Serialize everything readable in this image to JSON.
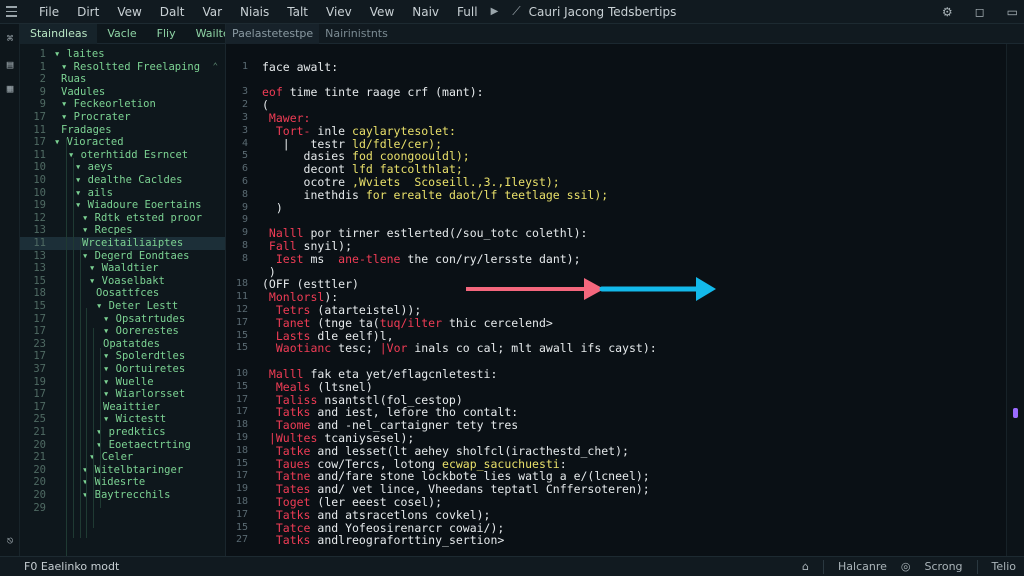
{
  "menubar": {
    "items": [
      "File",
      "Dirt",
      "Vew",
      "Dalt",
      "Var",
      "Niais",
      "Talt",
      "Viev",
      "Vew",
      "Naiv",
      "Full"
    ],
    "title": "Cauri Jacong Tedsbertips",
    "icons": [
      "hamburger-icon",
      "play-icon",
      "logo-icon",
      "settings-icon",
      "minimize-icon",
      "close-icon"
    ]
  },
  "explorer": {
    "tabs": [
      "Staindleas",
      "Vacle",
      "Fliy",
      "Wailtes"
    ],
    "tree": [
      {
        "ln": "1",
        "label": "▾ laites",
        "indent": 0
      },
      {
        "ln": "1",
        "label": "▾ Resoltted Freelaping",
        "indent": 1,
        "chev": "⌃"
      },
      {
        "ln": "2",
        "label": "Ruas",
        "indent": 1
      },
      {
        "ln": "9",
        "label": "Vadules",
        "indent": 1
      },
      {
        "ln": "9",
        "label": "▾ Feckeorletion",
        "indent": 1
      },
      {
        "ln": "17",
        "label": "▾ Procrater",
        "indent": 1
      },
      {
        "ln": "11",
        "label": "Fradages",
        "indent": 1
      },
      {
        "ln": "17",
        "label": "▾ Vioracted",
        "indent": 0
      },
      {
        "ln": "11",
        "label": "▾ oterhtidd Esrncet",
        "indent": 2
      },
      {
        "ln": "10",
        "label": "▾ aeys",
        "indent": 3
      },
      {
        "ln": "10",
        "label": "▾ dealthe Cacldes",
        "indent": 3
      },
      {
        "ln": "10",
        "label": "▾ ails",
        "indent": 3
      },
      {
        "ln": "19",
        "label": "▾ Wiadoure Eoertains",
        "indent": 3
      },
      {
        "ln": "12",
        "label": "▾ Rdtk etsted proor",
        "indent": 4
      },
      {
        "ln": "13",
        "label": "▾ Recpes",
        "indent": 4
      },
      {
        "ln": "11",
        "label": "Wrceitailiaiptes",
        "indent": 4,
        "selected": true
      },
      {
        "ln": "13",
        "label": "▾ Degerd Eondtaes",
        "indent": 4
      },
      {
        "ln": "13",
        "label": "▾ Waaldtier",
        "indent": 5
      },
      {
        "ln": "15",
        "label": "▾ Voaselbakt",
        "indent": 5
      },
      {
        "ln": "18",
        "label": "Oosattfces",
        "indent": 6
      },
      {
        "ln": "15",
        "label": "▾ Deter Lestt",
        "indent": 6
      },
      {
        "ln": "17",
        "label": "▾ Opsatrtudes",
        "indent": 7
      },
      {
        "ln": "17",
        "label": "▾ Oorerestes",
        "indent": 7
      },
      {
        "ln": "23",
        "label": "Opatatdes",
        "indent": 7
      },
      {
        "ln": "17",
        "label": "▾ Spolerdtles",
        "indent": 7
      },
      {
        "ln": "37",
        "label": "▾ Oortuiretes",
        "indent": 7
      },
      {
        "ln": "19",
        "label": "▾ Wuelle",
        "indent": 7
      },
      {
        "ln": "17",
        "label": "▾ Wiarlorsset",
        "indent": 7
      },
      {
        "ln": "17",
        "label": "Weaittier",
        "indent": 7
      },
      {
        "ln": "25",
        "label": "▾ Wictestt",
        "indent": 7
      },
      {
        "ln": "21",
        "label": "▾ predktics",
        "indent": 6
      },
      {
        "ln": "20",
        "label": "▾ Eoetaectrting",
        "indent": 6
      },
      {
        "ln": "21",
        "label": "▾ Celer",
        "indent": 5
      },
      {
        "ln": "20",
        "label": "▾ Witelbtaringer",
        "indent": 4
      },
      {
        "ln": "20",
        "label": "▾ Widesrte",
        "indent": 4
      },
      {
        "ln": "20",
        "label": "▾ Baytrecchils",
        "indent": 4
      },
      {
        "ln": "29",
        "label": "",
        "indent": 0
      }
    ]
  },
  "editor": {
    "tabs": [
      "Paelastetestpe",
      "Nairinistnts"
    ],
    "lines": [
      {
        "ln": "",
        "segments": [
          {
            "c": "white",
            "t": ""
          }
        ]
      },
      {
        "ln": "1",
        "segments": [
          {
            "c": "white",
            "t": "face awalt:"
          }
        ]
      },
      {
        "ln": "",
        "segments": [
          {
            "c": "white",
            "t": ""
          }
        ]
      },
      {
        "ln": "3",
        "segments": [
          {
            "c": "red",
            "t": "eof "
          },
          {
            "c": "white",
            "t": "time tinte raage crf (mant):"
          }
        ]
      },
      {
        "ln": "2",
        "segments": [
          {
            "c": "white",
            "t": "("
          }
        ]
      },
      {
        "ln": "3",
        "segments": [
          {
            "c": "red",
            "t": " Mawer:"
          }
        ]
      },
      {
        "ln": "3",
        "segments": [
          {
            "c": "red",
            "t": "  Tort- "
          },
          {
            "c": "white",
            "t": "inle "
          },
          {
            "c": "yellow",
            "t": "caylarytesolet:"
          }
        ]
      },
      {
        "ln": "4",
        "segments": [
          {
            "c": "white",
            "t": "   |   testr "
          },
          {
            "c": "yellow",
            "t": "ld/fdle/cer);"
          }
        ]
      },
      {
        "ln": "5",
        "segments": [
          {
            "c": "white",
            "t": "      dasies "
          },
          {
            "c": "yellow",
            "t": "fod coongoouldl);"
          }
        ]
      },
      {
        "ln": "6",
        "segments": [
          {
            "c": "white",
            "t": "      decont "
          },
          {
            "c": "yellow",
            "t": "lfd fatcolthlat;"
          }
        ]
      },
      {
        "ln": "6",
        "segments": [
          {
            "c": "white",
            "t": "      ocotre "
          },
          {
            "c": "yellow",
            "t": ",Wviets  Scoseill.,3.,Ileyst);"
          }
        ]
      },
      {
        "ln": "8",
        "segments": [
          {
            "c": "white",
            "t": "      inethdis "
          },
          {
            "c": "yellow",
            "t": "for erealte daot/lf teetlage ssil);"
          }
        ]
      },
      {
        "ln": "9",
        "segments": [
          {
            "c": "white",
            "t": "  )"
          }
        ]
      },
      {
        "ln": "9",
        "segments": [
          {
            "c": "white",
            "t": ""
          }
        ]
      },
      {
        "ln": "9",
        "segments": [
          {
            "c": "red",
            "t": " Nalll "
          },
          {
            "c": "white",
            "t": "por tirner estlerted(/sou_totc colethl):"
          }
        ]
      },
      {
        "ln": "8",
        "segments": [
          {
            "c": "red",
            "t": " Fall "
          },
          {
            "c": "white",
            "t": "snyil);"
          }
        ]
      },
      {
        "ln": "8",
        "segments": [
          {
            "c": "red",
            "t": "  Iest "
          },
          {
            "c": "white",
            "t": "ms  "
          },
          {
            "c": "red",
            "t": "ane-tlene "
          },
          {
            "c": "white",
            "t": "the con/ry/lersste dant);"
          }
        ]
      },
      {
        "ln": "",
        "segments": [
          {
            "c": "white",
            "t": " )"
          }
        ]
      },
      {
        "ln": "18",
        "segments": [
          {
            "c": "white",
            "t": "(OFF (esttler)"
          }
        ]
      },
      {
        "ln": "11",
        "segments": [
          {
            "c": "red",
            "t": " Monlorsl"
          },
          {
            "c": "white",
            "t": "):"
          }
        ]
      },
      {
        "ln": "12",
        "segments": [
          {
            "c": "red",
            "t": "  Tetrs "
          },
          {
            "c": "white",
            "t": "(atarteistel));"
          }
        ]
      },
      {
        "ln": "17",
        "segments": [
          {
            "c": "red",
            "t": "  Tanet "
          },
          {
            "c": "white",
            "t": "(tnge ta("
          },
          {
            "c": "red",
            "t": "tuq/ilter "
          },
          {
            "c": "white",
            "t": "thic cercelend>"
          }
        ]
      },
      {
        "ln": "15",
        "segments": [
          {
            "c": "red",
            "t": "  Lasts "
          },
          {
            "c": "white",
            "t": "dle eelf)l,"
          }
        ]
      },
      {
        "ln": "15",
        "segments": [
          {
            "c": "red",
            "t": "  Waotianc "
          },
          {
            "c": "white",
            "t": "tesc; "
          },
          {
            "c": "red",
            "t": "|Vor "
          },
          {
            "c": "white",
            "t": "inals co cal; mlt awall ifs cayst):"
          }
        ]
      },
      {
        "ln": "",
        "segments": [
          {
            "c": "white",
            "t": ""
          }
        ]
      },
      {
        "ln": "10",
        "segments": [
          {
            "c": "red",
            "t": " Malll "
          },
          {
            "c": "white",
            "t": "fak eta yet/eflagcnletesti:"
          }
        ]
      },
      {
        "ln": "15",
        "segments": [
          {
            "c": "red",
            "t": "  Meals "
          },
          {
            "c": "white",
            "t": "(ltsnel)"
          }
        ]
      },
      {
        "ln": "17",
        "segments": [
          {
            "c": "red",
            "t": "  Taliss "
          },
          {
            "c": "white",
            "t": "nsantstl(fol_cestop)"
          }
        ]
      },
      {
        "ln": "17",
        "segments": [
          {
            "c": "red",
            "t": "  Tatks "
          },
          {
            "c": "white",
            "t": "and iest, lefore tho contalt:"
          }
        ]
      },
      {
        "ln": "18",
        "segments": [
          {
            "c": "red",
            "t": "  Taome "
          },
          {
            "c": "white",
            "t": "and -nel_cartaigner tety tres"
          }
        ]
      },
      {
        "ln": "19",
        "segments": [
          {
            "c": "red",
            "t": " |Wultes "
          },
          {
            "c": "white",
            "t": "tcaniysesel);"
          }
        ]
      },
      {
        "ln": "18",
        "segments": [
          {
            "c": "red",
            "t": "  Tatke "
          },
          {
            "c": "white",
            "t": "and lesset(lt aehey sholfcl(iracthestd_chet);"
          }
        ]
      },
      {
        "ln": "15",
        "segments": [
          {
            "c": "red",
            "t": "  Taues "
          },
          {
            "c": "white",
            "t": "cow/Tercs, lotong "
          },
          {
            "c": "yellow",
            "t": "ecwap_sacuchuesti"
          },
          {
            "c": "white",
            "t": ":"
          }
        ]
      },
      {
        "ln": "17",
        "segments": [
          {
            "c": "red",
            "t": "  Tatne "
          },
          {
            "c": "white",
            "t": "and/fare stone lockbote lies watlg a e/(lcneel);"
          }
        ]
      },
      {
        "ln": "19",
        "segments": [
          {
            "c": "red",
            "t": "  Tates "
          },
          {
            "c": "white",
            "t": "and/ vet lince, Vheedans teptatl Cnffersoteren);"
          }
        ]
      },
      {
        "ln": "18",
        "segments": [
          {
            "c": "red",
            "t": "  Toget "
          },
          {
            "c": "white",
            "t": "(ler eeest cosel);"
          }
        ]
      },
      {
        "ln": "17",
        "segments": [
          {
            "c": "red",
            "t": "  Tatks "
          },
          {
            "c": "white",
            "t": "and atsracetlons covkel);"
          }
        ]
      },
      {
        "ln": "15",
        "segments": [
          {
            "c": "red",
            "t": "  Tatce "
          },
          {
            "c": "white",
            "t": "and Yofeosirenarcr cowai/);"
          }
        ]
      },
      {
        "ln": "27",
        "segments": [
          {
            "c": "red",
            "t": "  Tatks "
          },
          {
            "c": "white",
            "t": "andlreograforttiny_sertion>"
          }
        ]
      }
    ]
  },
  "statusbar": {
    "left": "F0 Eaelinko modt",
    "right": [
      "Halcanre",
      "Scrong",
      "Telio"
    ]
  },
  "colors": {
    "arrow_red": "#f4677d",
    "arrow_blue": "#13b9ea",
    "keyword_red": "#ef3c55",
    "string_yellow": "#e9e06a",
    "tree_green": "#7cd393"
  }
}
